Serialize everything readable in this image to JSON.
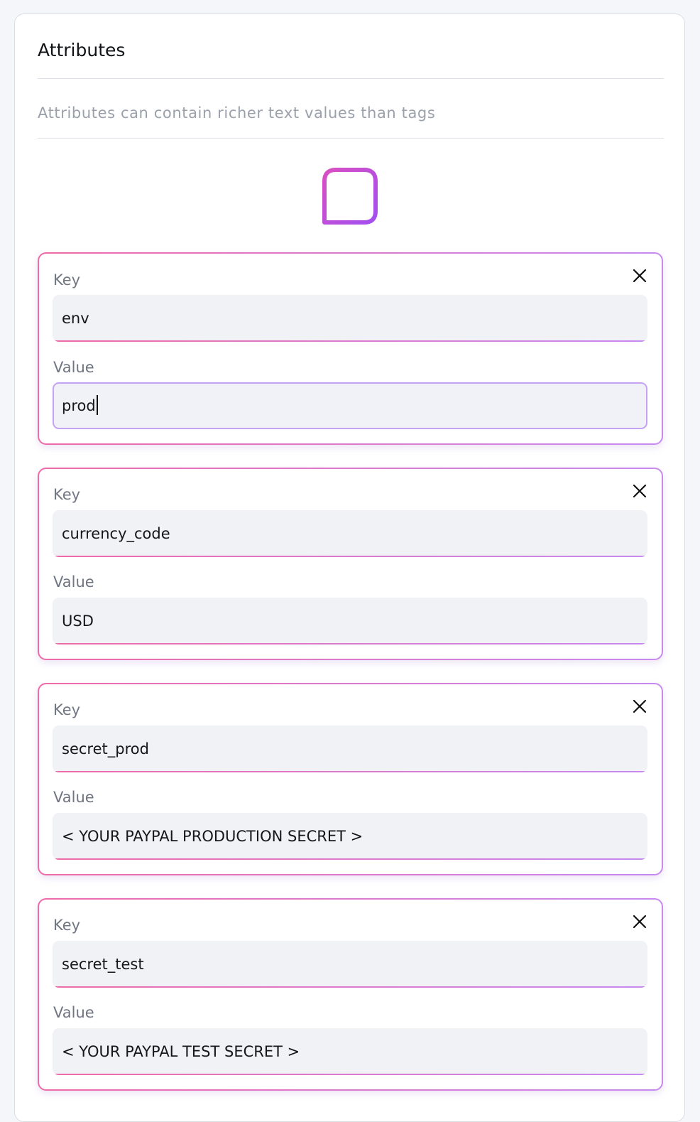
{
  "panel": {
    "title": "Attributes",
    "description": "Attributes can contain richer text values than tags",
    "add_icon": "plus-square-icon"
  },
  "accent": {
    "pink": "#ef6aa8",
    "purple": "#c78af0",
    "icon_start": "#d94fc3",
    "icon_end": "#a24ff0"
  },
  "attributes": [
    {
      "key_label": "Key",
      "key": "env",
      "value_label": "Value",
      "value": "prod",
      "focused": true
    },
    {
      "key_label": "Key",
      "key": "currency_code",
      "value_label": "Value",
      "value": "USD",
      "focused": false
    },
    {
      "key_label": "Key",
      "key": "secret_prod",
      "value_label": "Value",
      "value": "< YOUR PAYPAL PRODUCTION SECRET >",
      "focused": false
    },
    {
      "key_label": "Key",
      "key": "secret_test",
      "value_label": "Value",
      "value": "< YOUR PAYPAL TEST SECRET >",
      "focused": false
    }
  ]
}
